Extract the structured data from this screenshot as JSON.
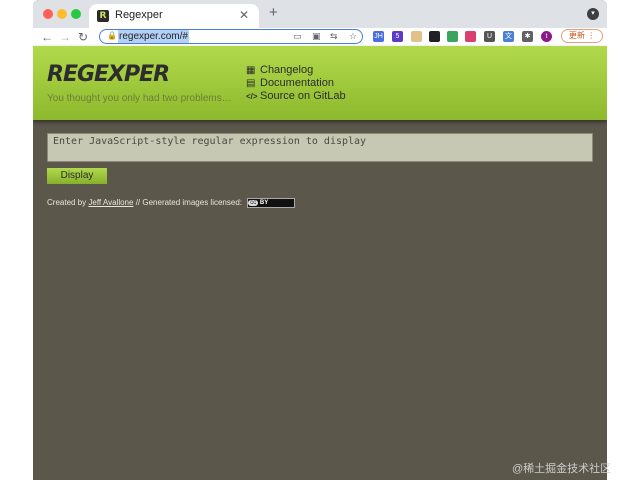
{
  "browser": {
    "tab_title": "Regexper",
    "favicon_letter": "R",
    "url": "regexper.com/#",
    "update_label": "更新",
    "extensions": [
      {
        "name": "jh-ext",
        "label": "JH",
        "color": "#4a6ee0"
      },
      {
        "name": "badge-ext",
        "label": "5",
        "color": "#5b3cc4"
      },
      {
        "name": "shield-ext",
        "label": "",
        "color": "#e0c28a"
      },
      {
        "name": "square-ext",
        "label": "",
        "color": "#202124"
      },
      {
        "name": "leaf-ext",
        "label": "",
        "color": "#3aa55c"
      },
      {
        "name": "camera-ext",
        "label": "",
        "color": "#d94070"
      },
      {
        "name": "u-ext",
        "label": "U",
        "color": "#555555"
      },
      {
        "name": "translate-ext",
        "label": "文",
        "color": "#4a7fd6"
      },
      {
        "name": "puzzle-ext",
        "label": "✱",
        "color": "#5f6368"
      },
      {
        "name": "profile-avatar",
        "label": "t",
        "color": "#8a1a8a"
      }
    ]
  },
  "header": {
    "logo": "REGEXPER",
    "tagline": "You thought you only had two problems…",
    "links": [
      {
        "icon": "▦",
        "label": "Changelog"
      },
      {
        "icon": "▤",
        "label": "Documentation"
      },
      {
        "icon": "</>",
        "label": "Source on GitLab"
      }
    ]
  },
  "main": {
    "placeholder": "Enter JavaScript-style regular expression to display",
    "display_label": "Display"
  },
  "footer": {
    "created_by": "Created by",
    "author": "Jeff Avallone",
    "separator": "//",
    "licensed": "Generated images licensed:",
    "cc_label": "cc",
    "cc_by": "BY"
  },
  "watermark": "@稀土掘金技术社区"
}
